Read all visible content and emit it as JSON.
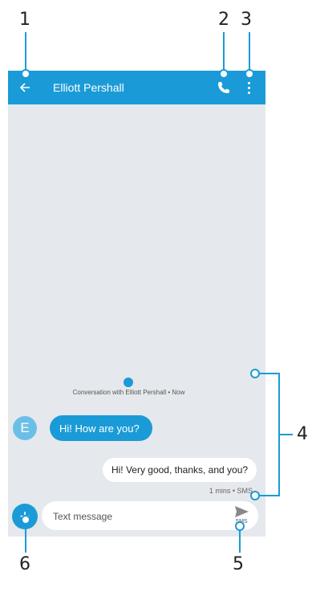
{
  "callouts": [
    "1",
    "2",
    "3",
    "4",
    "5",
    "6"
  ],
  "app_bar": {
    "title": "Elliott Pershall",
    "icons": [
      "back-arrow-icon",
      "phone-icon",
      "more-vert-icon"
    ],
    "color": "#1a9bd7"
  },
  "conversation": {
    "info": "Conversation with Elliott Pershall • Now",
    "avatar_letter": "E",
    "incoming": "Hi! How are you?",
    "outgoing": "Hi! Very good, thanks, and you?",
    "meta": "1 mins • SMS"
  },
  "composer": {
    "placeholder": "Text message",
    "send_label": "SMS",
    "add_icon": "+"
  },
  "colors": {
    "accent": "#1a9bd7",
    "background": "#e5e8ec"
  }
}
